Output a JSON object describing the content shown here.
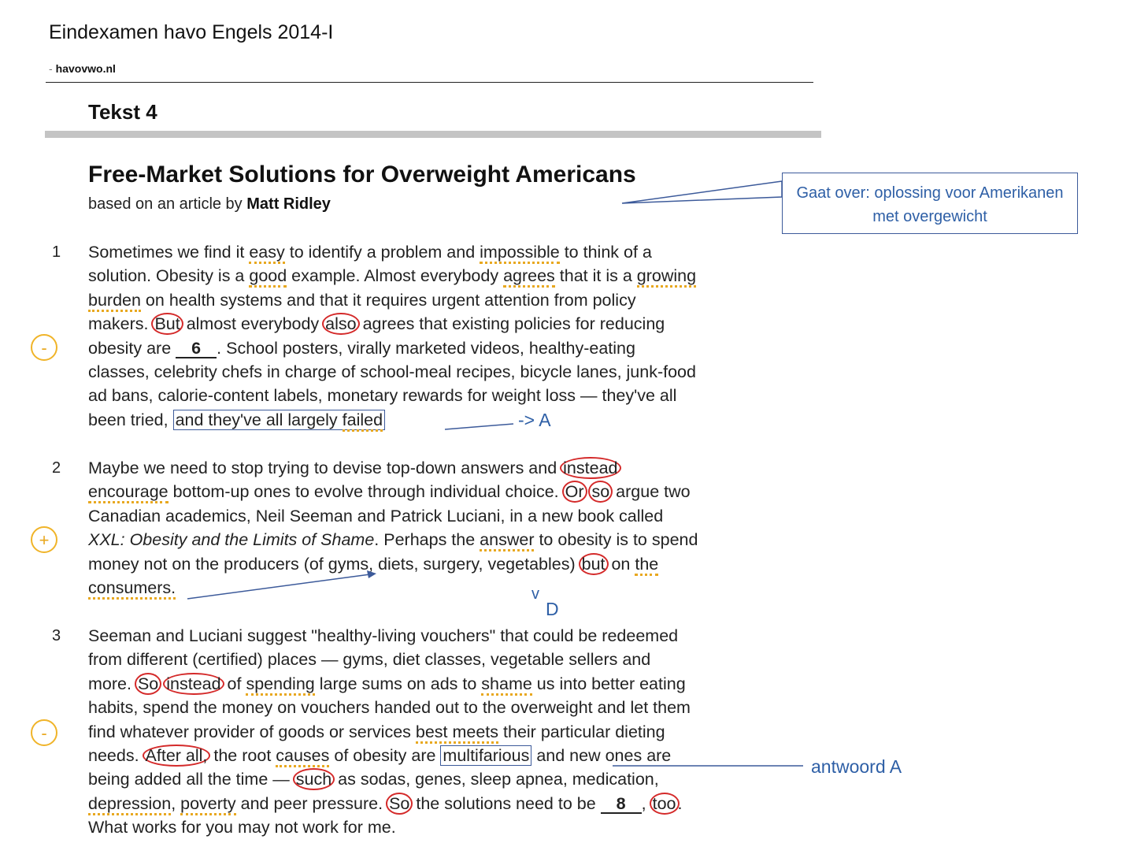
{
  "header": {
    "exam_title": "Eindexamen havo Engels  2014-I",
    "source_dash": "-",
    "source": "havovwo.nl",
    "text_label": "Tekst 4"
  },
  "article": {
    "title": "Free-Market Solutions for Overweight Americans",
    "byline_prefix": "based on an article by ",
    "byline_author": "Matt Ridley"
  },
  "paragraphs": [
    {
      "number": "1",
      "blank_number": "6"
    },
    {
      "number": "2"
    },
    {
      "number": "3",
      "blank_number": "8"
    }
  ],
  "annotations": {
    "summary_callout": "Gaat over: oplossing voor Amerikanen met overgewicht",
    "note_p1": "-> A",
    "note_p2_arrow": "v",
    "note_p2_letter": "D",
    "note_p3": "antwoord A",
    "margin_signs": [
      "-",
      "+",
      "-"
    ],
    "colors": {
      "circle": "#d42a2a",
      "box": "#3c5a9a",
      "note_text": "#2e5fa6",
      "highlight_dots": "#e8a820"
    }
  }
}
